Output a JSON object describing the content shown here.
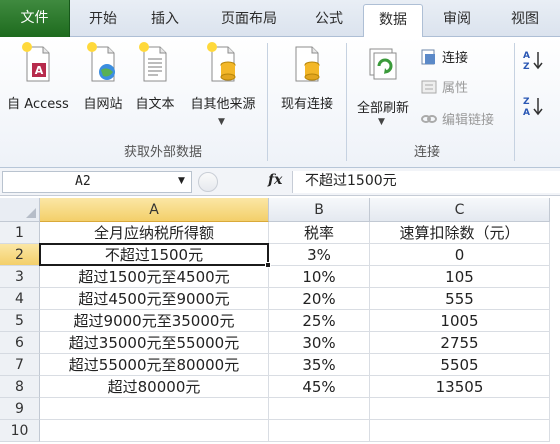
{
  "tabs": [
    {
      "label": "文件"
    },
    {
      "label": "开始"
    },
    {
      "label": "插入"
    },
    {
      "label": "页面布局"
    },
    {
      "label": "公式"
    },
    {
      "label": "数据"
    },
    {
      "label": "审阅"
    },
    {
      "label": "视图"
    }
  ],
  "active_tab": "数据",
  "ribbon": {
    "external_data": {
      "buttons": [
        {
          "label": "自 Access",
          "icon": "access-db-icon"
        },
        {
          "label": "自网站",
          "icon": "web-page-icon"
        },
        {
          "label": "自文本",
          "icon": "text-file-icon"
        },
        {
          "label": "自其他来源",
          "icon": "other-sources-icon"
        }
      ],
      "group_label": "获取外部数据"
    },
    "existing_connections": {
      "label": "现有连接",
      "icon": "existing-connections-icon"
    },
    "connections": {
      "refresh_all": "全部刷新",
      "connections_btn": "连接",
      "properties_btn": "属性",
      "edit_links_btn": "编辑链接",
      "group_label": "连接"
    },
    "sort": {
      "az": "A↓Z",
      "za": "Z↓A"
    }
  },
  "formula_bar": {
    "name_box": "A2",
    "fx_label": "fx",
    "formula": "不超过1500元"
  },
  "colors": {
    "file_tab": "#2e7d32",
    "selected_header": "#f3cf6a",
    "gridline": "#d9dde3"
  },
  "sheet": {
    "columns": [
      "A",
      "B",
      "C"
    ],
    "row_numbers": [
      "1",
      "2",
      "3",
      "4",
      "5",
      "6",
      "7",
      "8",
      "9",
      "10"
    ],
    "active_cell": "A2",
    "rows": [
      [
        "全月应纳税所得额",
        "税率",
        "速算扣除数（元）"
      ],
      [
        "不超过1500元",
        "3%",
        "0"
      ],
      [
        "超过1500元至4500元",
        "10%",
        "105"
      ],
      [
        "超过4500元至9000元",
        "20%",
        "555"
      ],
      [
        "超过9000元至35000元",
        "25%",
        "1005"
      ],
      [
        "超过35000元至55000元",
        "30%",
        "2755"
      ],
      [
        "超过55000元至80000元",
        "35%",
        "5505"
      ],
      [
        "超过80000元",
        "45%",
        "13505"
      ],
      [
        "",
        "",
        ""
      ],
      [
        "",
        "",
        ""
      ]
    ]
  }
}
